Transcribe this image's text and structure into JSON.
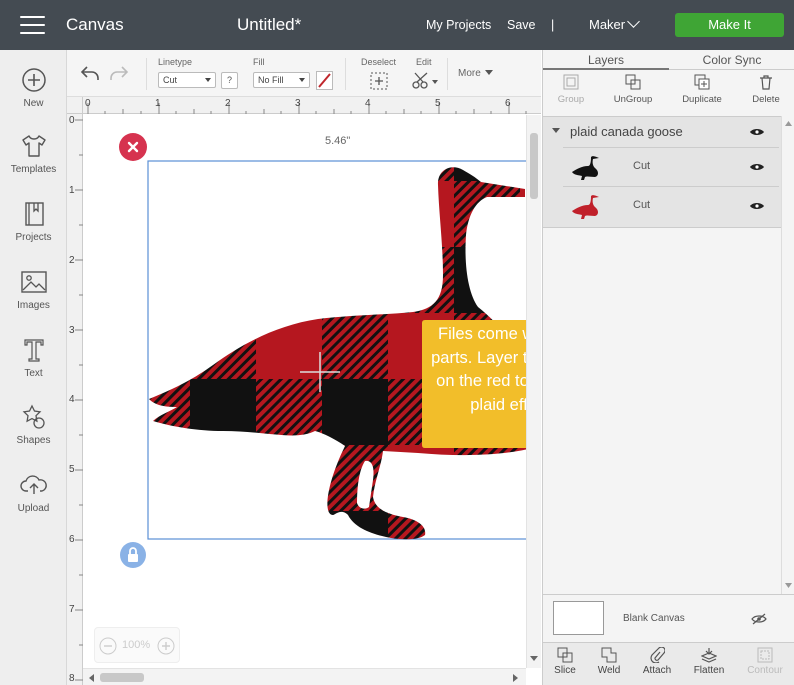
{
  "header": {
    "app_title": "Canvas",
    "doc_title": "Untitled*",
    "my_projects": "My Projects",
    "save": "Save",
    "separator": "|",
    "machine": "Maker",
    "make_it": "Make It"
  },
  "sidebar": {
    "items": [
      {
        "label": "New",
        "icon": "plus-circle-icon"
      },
      {
        "label": "Templates",
        "icon": "tshirt-icon"
      },
      {
        "label": "Projects",
        "icon": "book-icon"
      },
      {
        "label": "Images",
        "icon": "image-icon"
      },
      {
        "label": "Text",
        "icon": "text-icon"
      },
      {
        "label": "Shapes",
        "icon": "shapes-icon"
      },
      {
        "label": "Upload",
        "icon": "cloud-upload-icon"
      }
    ]
  },
  "toolbar": {
    "linetype_label": "Linetype",
    "linetype_value": "Cut",
    "help": "?",
    "fill_label": "Fill",
    "fill_value": "No Fill",
    "deselect_label": "Deselect",
    "edit_label": "Edit",
    "more_label": "More"
  },
  "rulers": {
    "top": [
      "0",
      "1",
      "2",
      "3",
      "4",
      "5",
      "6"
    ],
    "left": [
      "0",
      "1",
      "2",
      "3",
      "4",
      "5",
      "6",
      "7",
      "8"
    ]
  },
  "canvas": {
    "width_readout": "5.46\"",
    "zoom": "100%",
    "callout": "Files come with two parts. Layer the black on the red to get the plaid effect",
    "colors": {
      "red": "#b5171f",
      "black": "#111111",
      "callout": "#f2be2a",
      "selection": "#5b8fd6"
    }
  },
  "panel": {
    "tabs": [
      "Layers",
      "Color Sync"
    ],
    "tools": [
      "Group",
      "UnGroup",
      "Duplicate",
      "Delete"
    ],
    "group_name": "plaid canada goose",
    "layers": [
      {
        "label": "Cut",
        "color": "black"
      },
      {
        "label": "Cut",
        "color": "red"
      }
    ],
    "blank_canvas": "Blank Canvas",
    "bottom_tools": [
      "Slice",
      "Weld",
      "Attach",
      "Flatten",
      "Contour"
    ]
  }
}
